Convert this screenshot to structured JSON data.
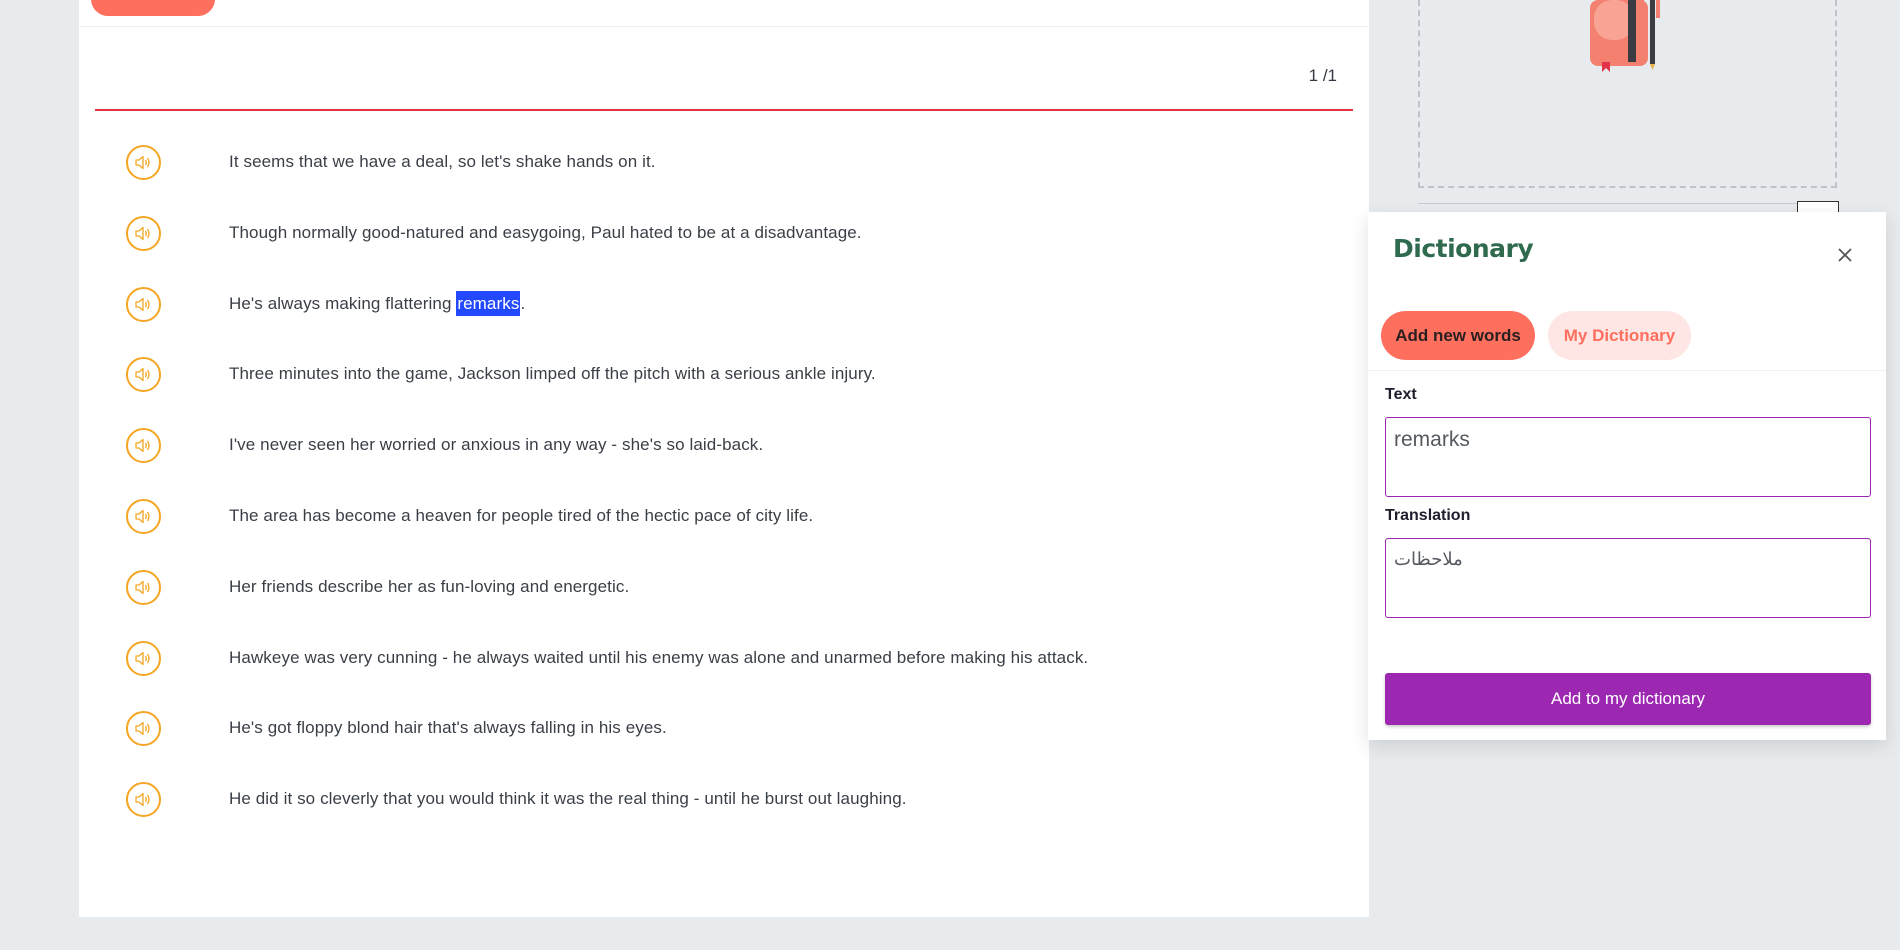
{
  "page": {
    "counter": "1 /1"
  },
  "sentences": [
    {
      "before": "It seems that we have a deal, so let's shake hands on it.",
      "highlight": "",
      "after": ""
    },
    {
      "before": "Though normally good-natured and easygoing, Paul hated to be at a disadvantage.",
      "highlight": "",
      "after": ""
    },
    {
      "before": "He's always making flattering ",
      "highlight": "remarks",
      "after": "."
    },
    {
      "before": "Three minutes into the game, Jackson limped off the pitch with a serious ankle injury.",
      "highlight": "",
      "after": ""
    },
    {
      "before": "I've never seen her worried or anxious in any way - she's so laid-back.",
      "highlight": "",
      "after": ""
    },
    {
      "before": "The area has become a heaven for people tired of the hectic pace of city life.",
      "highlight": "",
      "after": ""
    },
    {
      "before": "Her friends describe her as fun-loving and energetic.",
      "highlight": "",
      "after": ""
    },
    {
      "before": "Hawkeye was very cunning - he always waited until his enemy was alone and unarmed before making his attack.",
      "highlight": "",
      "after": ""
    },
    {
      "before": "He's got floppy blond hair that's always falling in his eyes.",
      "highlight": "",
      "after": ""
    },
    {
      "before": "He did it so cleverly that you would think it was the real thing - until he burst out laughing.",
      "highlight": "",
      "after": ""
    }
  ],
  "dictionary": {
    "title": "Dictionary",
    "tabs": {
      "add": "Add new words",
      "my": "My Dictionary"
    },
    "text_label": "Text",
    "text_value": "remarks",
    "translation_label": "Translation",
    "translation_value": "ملاحظات",
    "add_button": "Add to my dictionary"
  },
  "icons": {
    "speaker": "speaker-icon",
    "close": "close-icon",
    "book": "book-icon"
  },
  "colors": {
    "accent_orange": "#f5a623",
    "coral": "#ff6f5e",
    "purple": "#9c27b0",
    "highlight_blue": "#2349ff",
    "rule_red": "#e5333f",
    "title_green": "#2f6a4f"
  }
}
